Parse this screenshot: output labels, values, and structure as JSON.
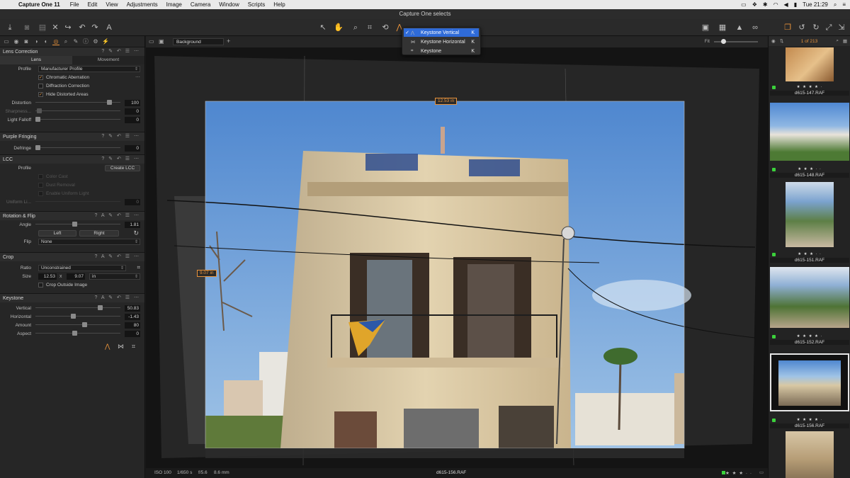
{
  "menubar": {
    "app_name": "Capture One 11",
    "items": [
      "File",
      "Edit",
      "View",
      "Adjustments",
      "Image",
      "Camera",
      "Window",
      "Scripts",
      "Help"
    ],
    "clock": "Tue 21:29"
  },
  "window": {
    "title": "Capture One selects"
  },
  "popup_menu": {
    "items": [
      {
        "label": "Keystone Vertical",
        "key": "K",
        "checked": "✓"
      },
      {
        "label": "Keystone Horizontal",
        "key": "K",
        "checked": ""
      },
      {
        "label": "Keystone",
        "key": "K",
        "checked": ""
      }
    ]
  },
  "lens_correction": {
    "title": "Lens Correction",
    "tabs": [
      "Lens",
      "Movement"
    ],
    "profile_label": "Profile",
    "profile_value": "Manufacturer Profile",
    "checks": [
      "Chromatic Aberration",
      "Diffraction Correction",
      "Hide Distorted Areas"
    ],
    "distortion_label": "Distortion",
    "distortion_value": "100",
    "sharpness_label": "Sharpness...",
    "sharpness_value": "0",
    "falloff_label": "Light Falloff",
    "falloff_value": "0"
  },
  "purple_fringing": {
    "title": "Purple Fringing",
    "defringe_label": "Defringe",
    "defringe_value": "0"
  },
  "lcc": {
    "title": "LCC",
    "profile_label": "Profile",
    "create_btn": "Create LCC",
    "checks": [
      "Color Cast",
      "Dust Removal",
      "Enable Uniform Light"
    ],
    "uniform_label": "Uniform Li...",
    "uniform_value": "0"
  },
  "rotation": {
    "title": "Rotation & Flip",
    "angle_label": "Angle",
    "angle_value": "1.81",
    "left_btn": "Left",
    "right_btn": "Right",
    "flip_label": "Flip",
    "flip_value": "None"
  },
  "crop": {
    "title": "Crop",
    "ratio_label": "Ratio",
    "ratio_value": "Unconstrained",
    "size_label": "Size",
    "width": "12.53",
    "x": "x",
    "height": "9.07",
    "unit": "in",
    "outside_label": "Crop Outside Image"
  },
  "keystone": {
    "title": "Keystone",
    "vertical_label": "Vertical",
    "vertical_value": "50.83",
    "horizontal_label": "Horizontal",
    "horizontal_value": "-1.43",
    "amount_label": "Amount",
    "amount_value": "80",
    "aspect_label": "Aspect",
    "aspect_value": "0"
  },
  "viewer": {
    "background_label": "Background",
    "fit_label": "Fit",
    "crop_width_label": "12.53 in",
    "crop_height_label": "9.07 in",
    "info": [
      "ISO 100",
      "1/650 s",
      "f/5.6",
      "8.6 mm"
    ],
    "filename": "d615-156.RAF",
    "rating": "★ ★ ★ · ·"
  },
  "browser": {
    "count": "1 of 213",
    "thumbs": [
      {
        "name": "d615-147.RAF",
        "stars": "★ ★ ★ ★ ·"
      },
      {
        "name": "d615-148.RAF",
        "stars": "★ ★ ★ · ·"
      },
      {
        "name": "d615-151.RAF",
        "stars": "★ ★ ★ · ·"
      },
      {
        "name": "d615-152.RAF",
        "stars": "★ ★ ★ ★ ·"
      },
      {
        "name": "d615-156.RAF",
        "stars": "★ ★ ★ ★ ·"
      }
    ]
  },
  "colors": {
    "accent": "#e8923a",
    "selection": "#2f6bd8",
    "green": "#3bd23b"
  }
}
